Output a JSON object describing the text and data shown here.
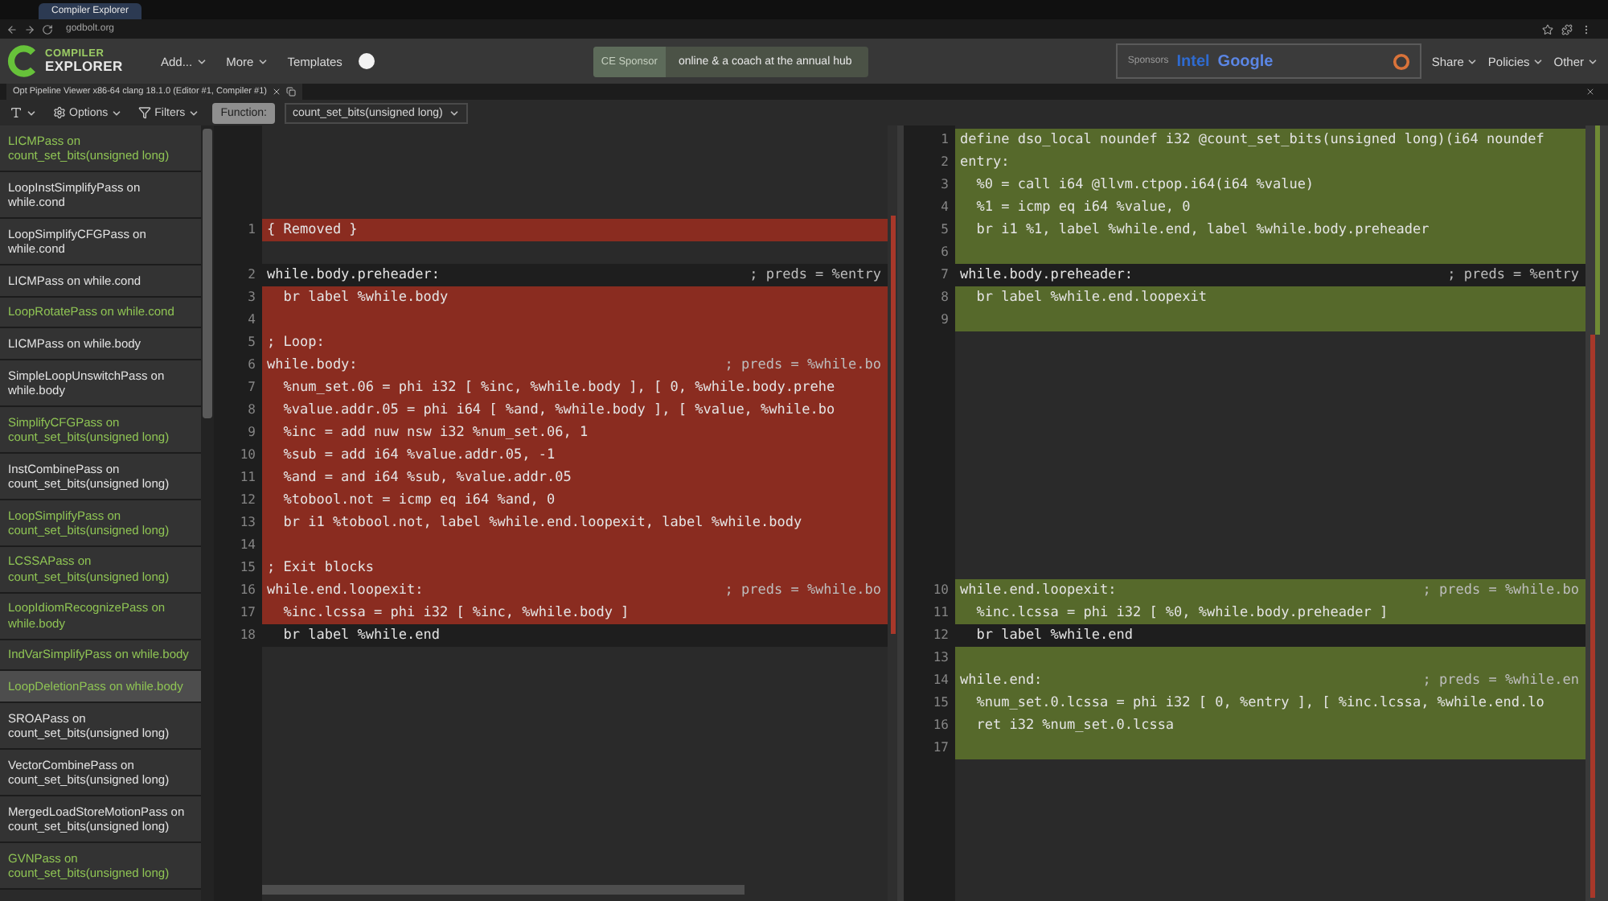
{
  "browser": {
    "tabs": [
      {
        "label": "Compiler Explorer",
        "selected": true
      }
    ],
    "address": "godbolt.org"
  },
  "header": {
    "logo_lines": [
      "COMPILER",
      "EXPLORER"
    ],
    "menus": [
      {
        "label": "Add...",
        "caret": true
      },
      {
        "label": "More",
        "caret": true
      },
      {
        "label": "Templates",
        "caret": false
      }
    ],
    "banner": {
      "label": "CE Sponsor",
      "text": "online & a coach at the annual hub"
    },
    "sponsors": {
      "label": "Sponsors",
      "names": [
        {
          "name": "Intel",
          "color": "#2f6bd0"
        },
        {
          "name": "Google",
          "color": "#5b86e5"
        }
      ]
    },
    "right_menus": [
      {
        "label": "Share",
        "caret": true
      },
      {
        "label": "Policies",
        "caret": true
      },
      {
        "label": "Other",
        "caret": true
      }
    ]
  },
  "pane": {
    "title": "Opt Pipeline Viewer x86-64 clang 18.1.0 (Editor #1, Compiler #1)"
  },
  "toolbar": {
    "options": "Options",
    "filters": "Filters",
    "function_label": "Function:",
    "function": "count_set_bits(unsigned long)"
  },
  "passes": [
    {
      "name": "LICMPass on count_set_bits(unsigned long)",
      "changed": true,
      "selected": false
    },
    {
      "name": "LoopInstSimplifyPass on while.cond",
      "changed": false,
      "selected": false
    },
    {
      "name": "LoopSimplifyCFGPass on while.cond",
      "changed": false,
      "selected": false
    },
    {
      "name": "LICMPass on while.cond",
      "changed": false,
      "selected": false
    },
    {
      "name": "LoopRotatePass on while.cond",
      "changed": true,
      "selected": false
    },
    {
      "name": "LICMPass on while.body",
      "changed": false,
      "selected": false
    },
    {
      "name": "SimpleLoopUnswitchPass on while.body",
      "changed": false,
      "selected": false
    },
    {
      "name": "SimplifyCFGPass on count_set_bits(unsigned long)",
      "changed": true,
      "selected": false
    },
    {
      "name": "InstCombinePass on count_set_bits(unsigned long)",
      "changed": false,
      "selected": false
    },
    {
      "name": "LoopSimplifyPass on count_set_bits(unsigned long)",
      "changed": true,
      "selected": false
    },
    {
      "name": "LCSSAPass on count_set_bits(unsigned long)",
      "changed": true,
      "selected": false
    },
    {
      "name": "LoopIdiomRecognizePass on while.body",
      "changed": true,
      "selected": false
    },
    {
      "name": "IndVarSimplifyPass on while.body",
      "changed": true,
      "selected": false
    },
    {
      "name": "LoopDeletionPass on while.body",
      "changed": true,
      "selected": true
    },
    {
      "name": "SROAPass on count_set_bits(unsigned long)",
      "changed": false,
      "selected": false
    },
    {
      "name": "VectorCombinePass on count_set_bits(unsigned long)",
      "changed": false,
      "selected": false
    },
    {
      "name": "MergedLoadStoreMotionPass on count_set_bits(unsigned long)",
      "changed": false,
      "selected": false
    },
    {
      "name": "GVNPass on count_set_bits(unsigned long)",
      "changed": true,
      "selected": false
    }
  ],
  "diff": {
    "before": [
      {
        "kind": "gap"
      },
      {
        "kind": "gap"
      },
      {
        "kind": "gap"
      },
      {
        "kind": "gap"
      },
      {
        "kind": "removed",
        "number": "1",
        "code": "{ Removed }"
      },
      {
        "kind": "gap"
      },
      {
        "kind": "context",
        "number": "2",
        "code": "while.body.preheader:",
        "comment": "; preds = %entry"
      },
      {
        "kind": "removed",
        "number": "3",
        "code": "  br label %while.body"
      },
      {
        "kind": "removed",
        "number": "4"
      },
      {
        "kind": "removed",
        "number": "5",
        "code": "; Loop:"
      },
      {
        "kind": "removed",
        "number": "6",
        "code": "while.body:",
        "comment": "; preds = %while.bo"
      },
      {
        "kind": "removed",
        "number": "7",
        "code": "  %num_set.06 = phi i32 [ %inc, %while.body ], [ 0, %while.body.prehe"
      },
      {
        "kind": "removed",
        "number": "8",
        "code": "  %value.addr.05 = phi i64 [ %and, %while.body ], [ %value, %while.bo"
      },
      {
        "kind": "removed",
        "number": "9",
        "code": "  %inc = add nuw nsw i32 %num_set.06, 1"
      },
      {
        "kind": "removed",
        "number": "10",
        "code": "  %sub = add i64 %value.addr.05, -1"
      },
      {
        "kind": "removed",
        "number": "11",
        "code": "  %and = and i64 %sub, %value.addr.05"
      },
      {
        "kind": "removed",
        "number": "12",
        "code": "  %tobool.not = icmp eq i64 %and, 0"
      },
      {
        "kind": "removed",
        "number": "13",
        "code": "  br i1 %tobool.not, label %while.end.loopexit, label %while.body"
      },
      {
        "kind": "removed",
        "number": "14"
      },
      {
        "kind": "removed",
        "number": "15",
        "code": "; Exit blocks"
      },
      {
        "kind": "removed",
        "number": "16",
        "code": "while.end.loopexit:",
        "comment": "; preds = %while.bo"
      },
      {
        "kind": "removed",
        "number": "17",
        "code": "  %inc.lcssa = phi i32 [ %inc, %while.body ]"
      },
      {
        "kind": "context",
        "number": "18",
        "code": "  br label %while.end"
      }
    ],
    "after": [
      {
        "kind": "inserted",
        "number": "1",
        "code": "define dso_local noundef i32 @count_set_bits(unsigned long)(i64 noundef"
      },
      {
        "kind": "inserted",
        "number": "2",
        "code": "entry:"
      },
      {
        "kind": "inserted",
        "number": "3",
        "code": "  %0 = call i64 @llvm.ctpop.i64(i64 %value)"
      },
      {
        "kind": "inserted",
        "number": "4",
        "code": "  %1 = icmp eq i64 %value, 0"
      },
      {
        "kind": "inserted",
        "number": "5",
        "code": "  br i1 %1, label %while.end, label %while.body.preheader"
      },
      {
        "kind": "inserted",
        "number": "6"
      },
      {
        "kind": "context",
        "number": "7",
        "code": "while.body.preheader:",
        "comment": "; preds = %entry"
      },
      {
        "kind": "inserted",
        "number": "8",
        "code": "  br label %while.end.loopexit"
      },
      {
        "kind": "inserted",
        "number": "9"
      },
      {
        "kind": "gap"
      },
      {
        "kind": "gap"
      },
      {
        "kind": "gap"
      },
      {
        "kind": "gap"
      },
      {
        "kind": "gap"
      },
      {
        "kind": "gap"
      },
      {
        "kind": "gap"
      },
      {
        "kind": "gap"
      },
      {
        "kind": "gap"
      },
      {
        "kind": "gap"
      },
      {
        "kind": "gap"
      },
      {
        "kind": "inserted",
        "number": "10",
        "code": "while.end.loopexit:",
        "comment": "; preds = %while.bo"
      },
      {
        "kind": "inserted",
        "number": "11",
        "code": "  %inc.lcssa = phi i32 [ %0, %while.body.preheader ]"
      },
      {
        "kind": "context",
        "number": "12",
        "code": "  br label %while.end"
      },
      {
        "kind": "inserted",
        "number": "13"
      },
      {
        "kind": "inserted",
        "number": "14",
        "code": "while.end:",
        "comment": "; preds = %while.en"
      },
      {
        "kind": "inserted",
        "number": "15",
        "code": "  %num_set.0.lcssa = phi i32 [ 0, %entry ], [ %inc.lcssa, %while.end.lo"
      },
      {
        "kind": "inserted",
        "number": "16",
        "code": "  ret i32 %num_set.0.lcssa"
      },
      {
        "kind": "inserted",
        "number": "17"
      }
    ]
  }
}
